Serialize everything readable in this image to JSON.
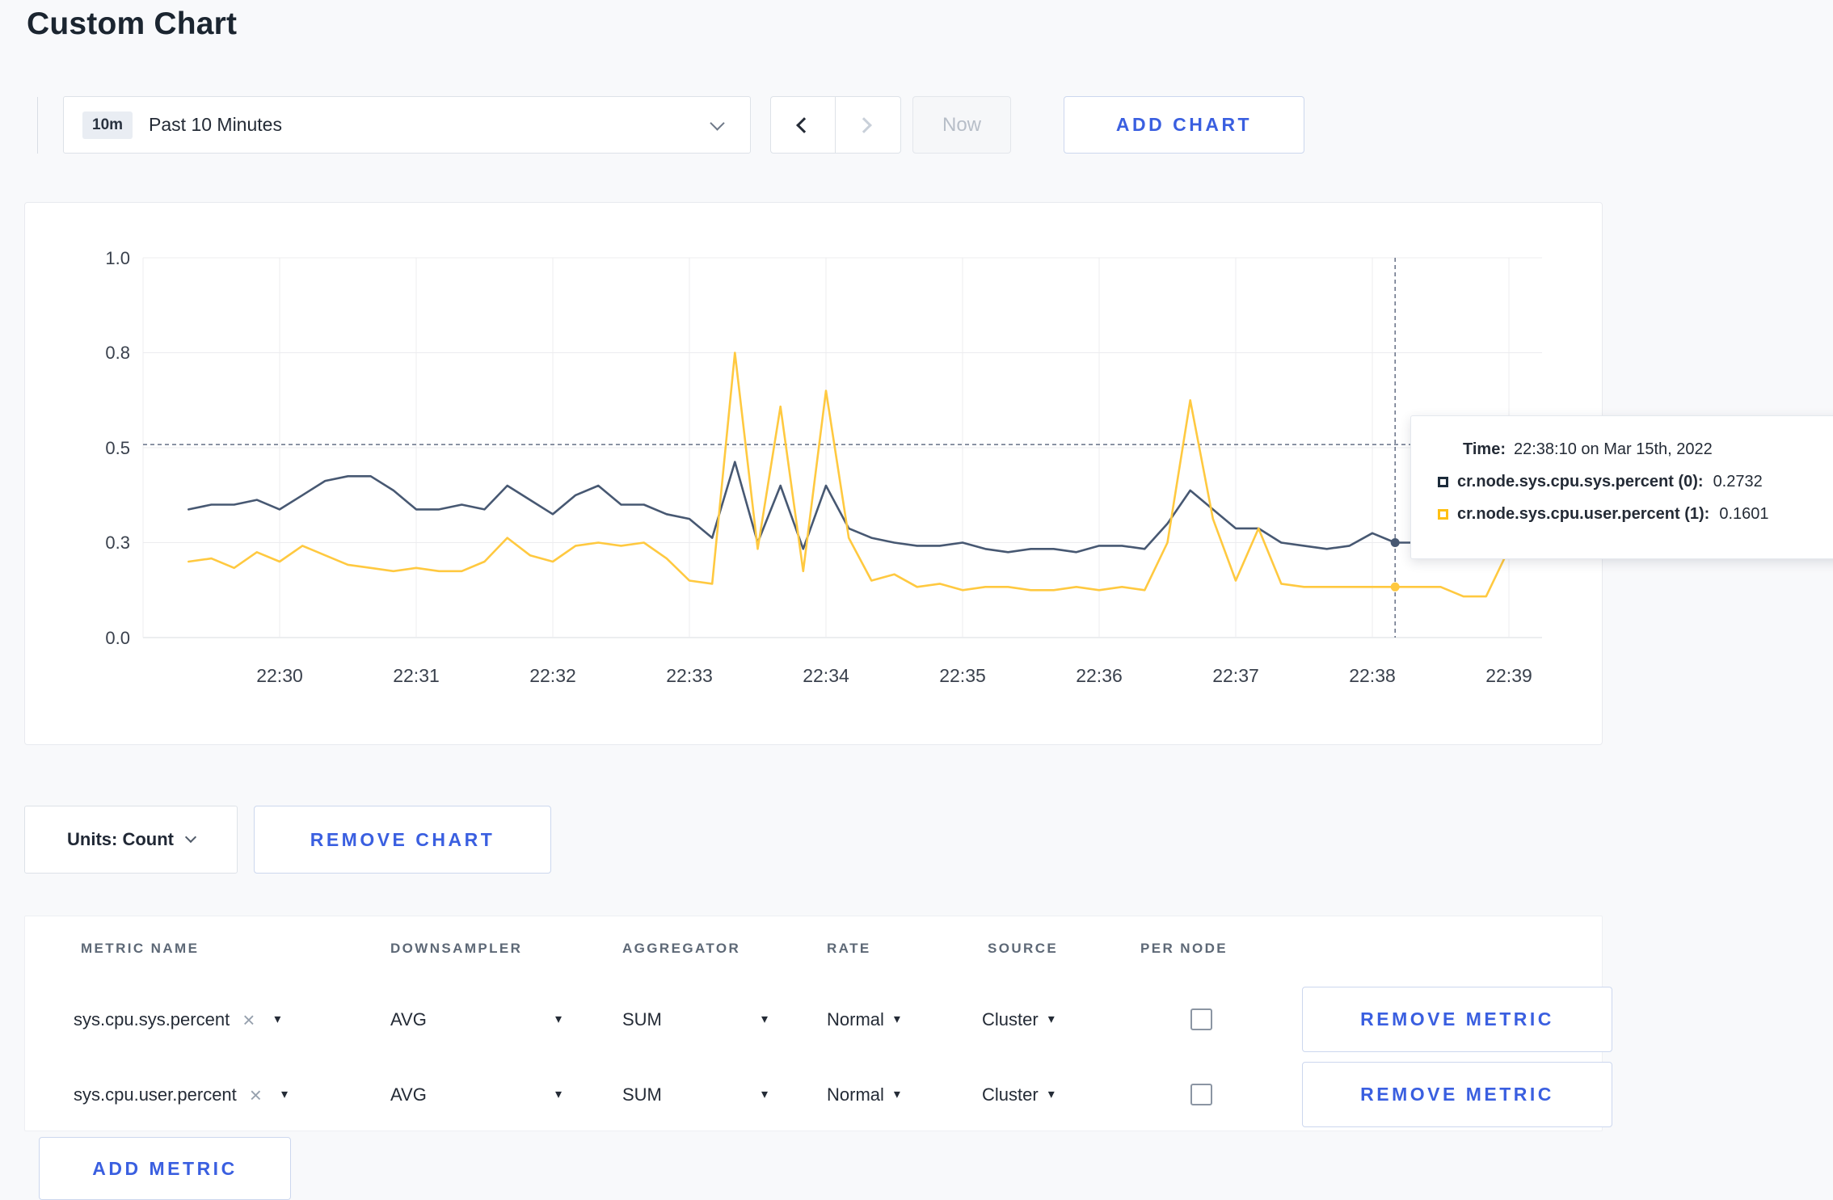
{
  "page": {
    "title": "Custom Chart"
  },
  "colors": {
    "accent": "#3a5fe0",
    "series_sys": "#475872",
    "series_user": "#ffc940",
    "grid": "#ececef",
    "crosshair": "#667086"
  },
  "toolbar": {
    "time_badge": "10m",
    "time_label": "Past 10 Minutes",
    "now_label": "Now",
    "add_chart_label": "ADD CHART"
  },
  "chart_data": {
    "type": "line",
    "title": "",
    "xlabel": "",
    "ylabel": "",
    "grid": true,
    "ylim": [
      0,
      1
    ],
    "yticks": [
      "1.0",
      "0.8",
      "0.5",
      "0.3",
      "0.0"
    ],
    "ytick_values": [
      1.0,
      0.8,
      0.5,
      0.3,
      0.0
    ],
    "xticks": [
      "22:30",
      "22:31",
      "22:32",
      "22:33",
      "22:34",
      "22:35",
      "22:36",
      "22:37",
      "22:38",
      "22:39"
    ],
    "x_start": "22:29:20",
    "t0_seconds": 20,
    "x_step_seconds": 10,
    "series": [
      {
        "name": "cr.node.sys.cpu.sys.percent",
        "color": "#475872",
        "values": [
          0.37,
          0.38,
          0.38,
          0.39,
          0.37,
          0.4,
          0.43,
          0.44,
          0.44,
          0.41,
          0.37,
          0.37,
          0.38,
          0.37,
          0.42,
          0.39,
          0.36,
          0.4,
          0.42,
          0.38,
          0.38,
          0.36,
          0.35,
          0.31,
          0.47,
          0.3,
          0.42,
          0.28,
          0.42,
          0.33,
          0.31,
          0.3,
          0.29,
          0.29,
          0.3,
          0.28,
          0.27,
          0.28,
          0.28,
          0.27,
          0.29,
          0.29,
          0.28,
          0.34,
          0.41,
          0.37,
          0.33,
          0.33,
          0.3,
          0.29,
          0.28,
          0.29,
          0.32,
          0.3,
          0.3,
          0.3,
          0.29,
          0.31,
          0.32
        ]
      },
      {
        "name": "cr.node.sys.cpu.user.percent",
        "color": "#ffc940",
        "values": [
          0.24,
          0.25,
          0.22,
          0.27,
          0.24,
          0.29,
          0.26,
          0.23,
          0.22,
          0.21,
          0.22,
          0.21,
          0.21,
          0.24,
          0.31,
          0.26,
          0.24,
          0.29,
          0.3,
          0.29,
          0.3,
          0.25,
          0.18,
          0.17,
          0.8,
          0.28,
          0.63,
          0.21,
          0.68,
          0.31,
          0.18,
          0.2,
          0.16,
          0.17,
          0.15,
          0.16,
          0.16,
          0.15,
          0.15,
          0.16,
          0.15,
          0.16,
          0.15,
          0.3,
          0.65,
          0.35,
          0.18,
          0.33,
          0.17,
          0.16,
          0.16,
          0.16,
          0.16,
          0.16,
          0.16,
          0.16,
          0.13,
          0.13,
          0.28
        ]
      }
    ],
    "hover": {
      "time": "22:38:10",
      "seconds_from_22_29": 550,
      "value_line": 0.51
    }
  },
  "tooltip": {
    "time_label": "Time:",
    "time_value": "22:38:10 on Mar 15th, 2022",
    "series": [
      {
        "name": "cr.node.sys.cpu.sys.percent (0):",
        "value": "0.2732",
        "color": "#1c2b3a"
      },
      {
        "name": "cr.node.sys.cpu.user.percent (1):",
        "value": "0.1601",
        "color": "#ffc013"
      }
    ]
  },
  "units": {
    "label": "Units: Count",
    "remove_chart_label": "REMOVE CHART"
  },
  "metrics_table": {
    "headers": [
      "METRIC NAME",
      "DOWNSAMPLER",
      "AGGREGATOR",
      "RATE",
      "SOURCE",
      "PER NODE"
    ],
    "rows": [
      {
        "metric": "sys.cpu.sys.percent",
        "downsampler": "AVG",
        "aggregator": "SUM",
        "rate": "Normal",
        "source": "Cluster",
        "per_node_checked": false,
        "remove_label": "REMOVE METRIC"
      },
      {
        "metric": "sys.cpu.user.percent",
        "downsampler": "AVG",
        "aggregator": "SUM",
        "rate": "Normal",
        "source": "Cluster",
        "per_node_checked": false,
        "remove_label": "REMOVE METRIC"
      }
    ],
    "add_metric_label": "ADD METRIC"
  },
  "icons": {
    "caret_down": "▾",
    "close": "×"
  }
}
